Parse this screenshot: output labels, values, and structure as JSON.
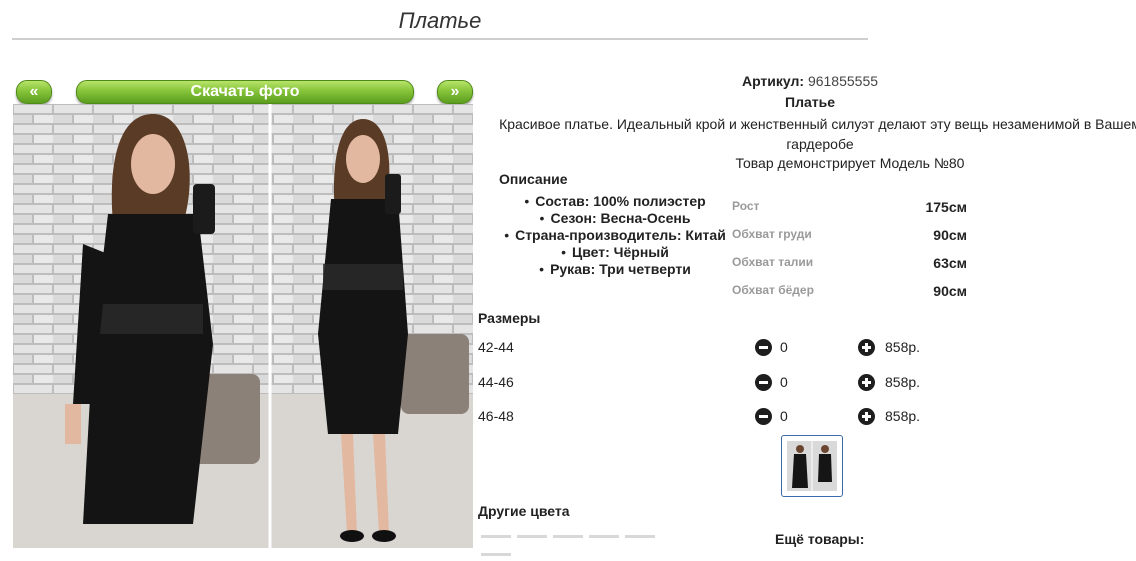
{
  "page": {
    "title": "Платье"
  },
  "gallery": {
    "prev_label": "«",
    "download_label": "Скачать фото",
    "next_label": "»"
  },
  "product": {
    "article_label": "Артикул:",
    "article_value": "961855555",
    "name": "Платье",
    "description": "Красивое платье. Идеальный крой и женственный силуэт делают эту вещь незаменимой в Вашем гардеробе",
    "model_line": "Товар демонстрирует Модель №80"
  },
  "specs": {
    "heading": "Описание",
    "items": [
      "Состав: 100% полиэстер",
      "Сезон: Весна-Осень",
      "Страна-производитель: Китай",
      "Цвет: Чёрный",
      "Рукав: Три четверти"
    ]
  },
  "measurements": [
    {
      "label": "Рост",
      "value": "175см"
    },
    {
      "label": "Обхват груди",
      "value": "90см"
    },
    {
      "label": "Обхват талии",
      "value": "63см"
    },
    {
      "label": "Обхват бёдер",
      "value": "90см"
    }
  ],
  "sizes": {
    "heading": "Размеры",
    "rows": [
      {
        "size": "42-44",
        "qty": "0",
        "price": "858р."
      },
      {
        "size": "44-46",
        "qty": "0",
        "price": "858р."
      },
      {
        "size": "46-48",
        "qty": "0",
        "price": "858р."
      }
    ]
  },
  "other_colors": {
    "heading": "Другие цвета"
  },
  "more_products": {
    "heading": "Ещё товары:"
  },
  "icons": {
    "minus": "minus-circle-icon",
    "plus": "plus-circle-icon"
  },
  "colors": {
    "accent_green": "#7cba2e",
    "thumb_border": "#3d6aa8"
  }
}
